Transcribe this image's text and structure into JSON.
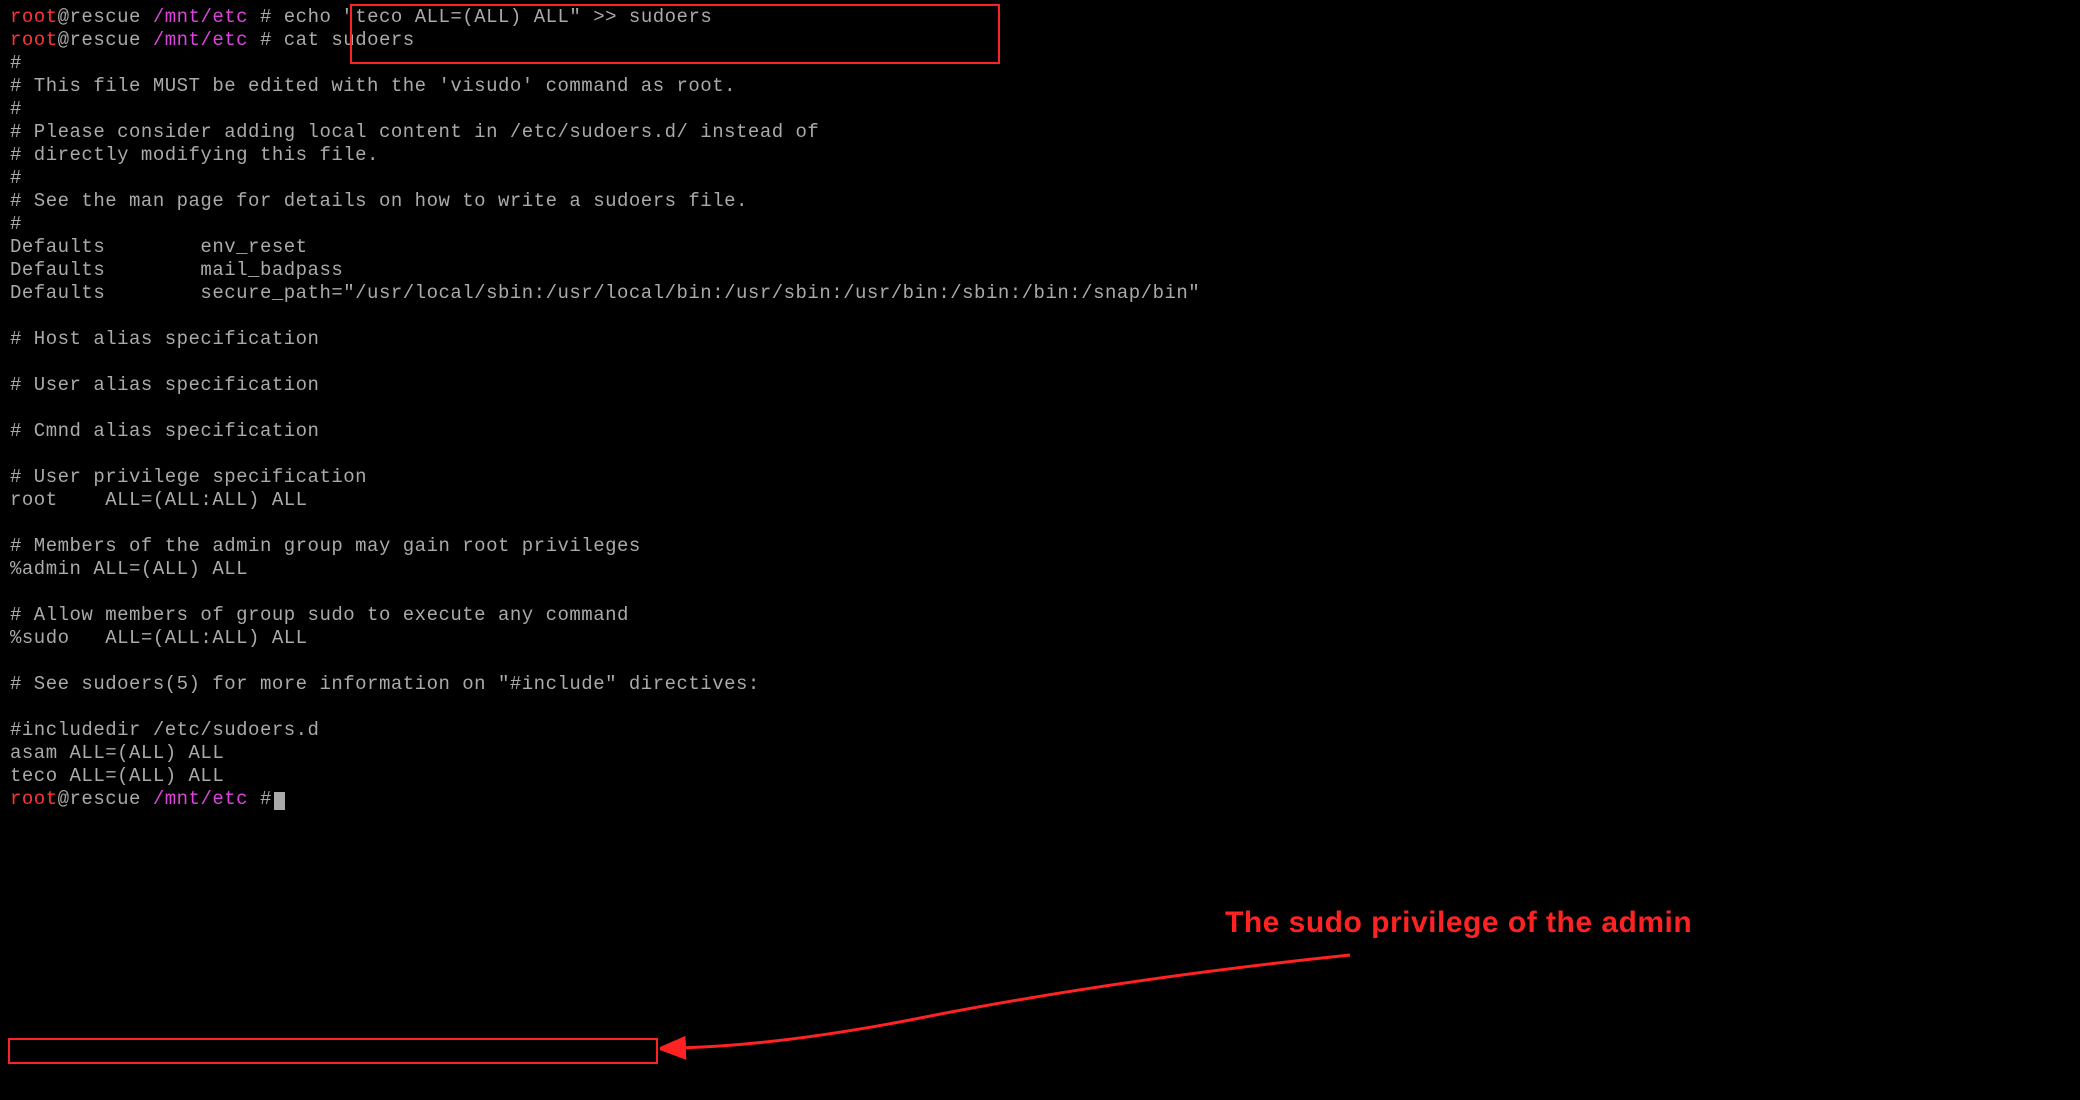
{
  "prompt": {
    "user": "root",
    "at": "@",
    "host": "rescue",
    "path": "/mnt/etc",
    "sep": " #"
  },
  "commands": {
    "cmd1": " echo \"teco ALL=(ALL) ALL\" >> sudoers",
    "cmd2": " cat sudoers"
  },
  "sudoers": {
    "l01": "#",
    "l02": "# This file MUST be edited with the 'visudo' command as root.",
    "l03": "#",
    "l04": "# Please consider adding local content in /etc/sudoers.d/ instead of",
    "l05": "# directly modifying this file.",
    "l06": "#",
    "l07": "# See the man page for details on how to write a sudoers file.",
    "l08": "#",
    "l09": "Defaults        env_reset",
    "l10": "Defaults        mail_badpass",
    "l11": "Defaults        secure_path=\"/usr/local/sbin:/usr/local/bin:/usr/sbin:/usr/bin:/sbin:/bin:/snap/bin\"",
    "l12": "",
    "l13": "# Host alias specification",
    "l14": "",
    "l15": "# User alias specification",
    "l16": "",
    "l17": "# Cmnd alias specification",
    "l18": "",
    "l19": "# User privilege specification",
    "l20": "root    ALL=(ALL:ALL) ALL",
    "l21": "",
    "l22": "# Members of the admin group may gain root privileges",
    "l23": "%admin ALL=(ALL) ALL",
    "l24": "",
    "l25": "# Allow members of group sudo to execute any command",
    "l26": "%sudo   ALL=(ALL:ALL) ALL",
    "l27": "",
    "l28": "# See sudoers(5) for more information on \"#include\" directives:",
    "l29": "",
    "l30": "#includedir /etc/sudoers.d",
    "l31": "asam ALL=(ALL) ALL",
    "l32": "teco ALL=(ALL) ALL"
  },
  "annotation": {
    "label": "The sudo privilege of the admin"
  }
}
